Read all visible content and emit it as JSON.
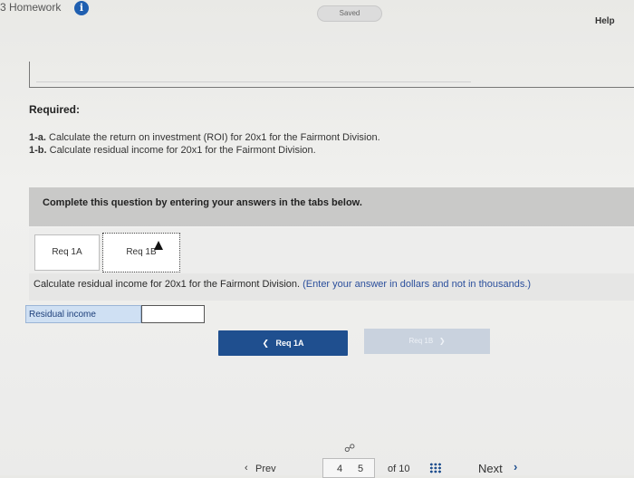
{
  "header": {
    "title": "3 Homework",
    "info_icon": "info-icon",
    "saved_label": "Saved",
    "help_label": "Help"
  },
  "required": {
    "heading": "Required:",
    "items": [
      {
        "id": "1-a.",
        "text": "Calculate the return on investment (ROI) for 20x1 for the Fairmont Division."
      },
      {
        "id": "1-b.",
        "text": "Calculate residual income for 20x1 for the Fairmont Division."
      }
    ]
  },
  "banner": {
    "text": "Complete this question by entering your answers in the tabs below."
  },
  "tabs": [
    {
      "label": "Req 1A",
      "active": false
    },
    {
      "label": "Req 1B",
      "active": true
    }
  ],
  "question": {
    "text": "Calculate residual income for 20x1 for the Fairmont Division.",
    "note": "(Enter your answer in dollars and not in thousands.)"
  },
  "answer": {
    "label": "Residual income",
    "value": ""
  },
  "nav": {
    "prev_label": "Req 1A",
    "next_label": "Req 1B"
  },
  "pagination": {
    "prev_label": "Prev",
    "pages": [
      "4",
      "5"
    ],
    "of_label": "of 10",
    "next_label": "Next"
  },
  "colors": {
    "accent": "#1f4f8f",
    "note": "#2b4f9c",
    "answer_label_bg": "#cfe0f3"
  }
}
